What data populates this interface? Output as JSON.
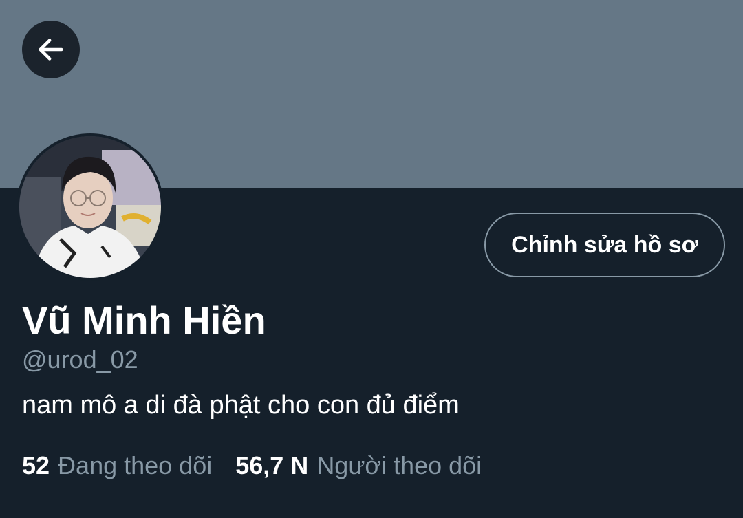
{
  "header": {
    "back_icon": "arrow-left-icon"
  },
  "profile": {
    "display_name": "Vũ Minh Hiền",
    "handle": "@urod_02",
    "bio": "nam mô a di đà phật cho con đủ điểm",
    "edit_button_label": "Chỉnh sửa hồ sơ",
    "avatar_icon": "profile-photo"
  },
  "stats": {
    "following_count": "52",
    "following_label": "Đang theo dõi",
    "followers_count": "56,7 N",
    "followers_label": "Người theo dõi"
  },
  "colors": {
    "background": "#15202b",
    "banner": "#657786",
    "muted_text": "#8899a6",
    "primary_text": "#ffffff",
    "button_border": "#8899a6"
  }
}
